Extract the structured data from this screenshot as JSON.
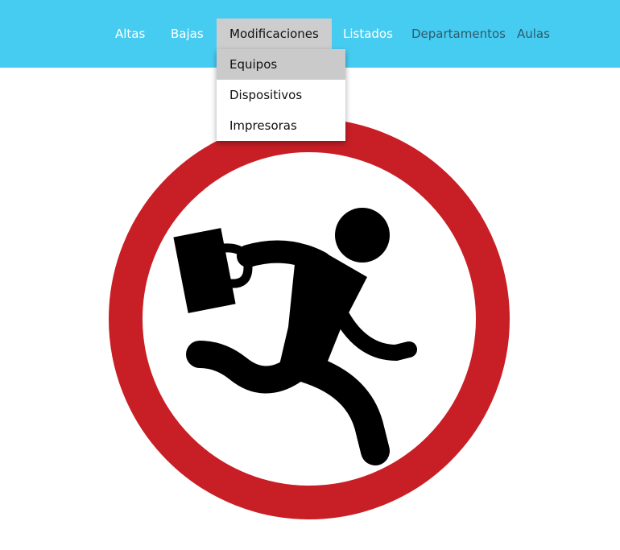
{
  "nav": {
    "items": [
      {
        "label": "Altas"
      },
      {
        "label": "Bajas"
      },
      {
        "label": "Modificaciones"
      },
      {
        "label": "Listados"
      },
      {
        "label": "Departamentos"
      },
      {
        "label": "Aulas"
      }
    ],
    "active_item": "Modificaciones",
    "bar_color": "#47ccf1"
  },
  "dropdown": {
    "items": [
      {
        "label": "Equipos"
      },
      {
        "label": "Dispositivos"
      },
      {
        "label": "Impresoras"
      }
    ],
    "hovered_item": "Equipos"
  },
  "hero": {
    "icon": "running-man-prohibition-icon",
    "ring_color": "#c81f26",
    "figure_color": "#000000"
  }
}
